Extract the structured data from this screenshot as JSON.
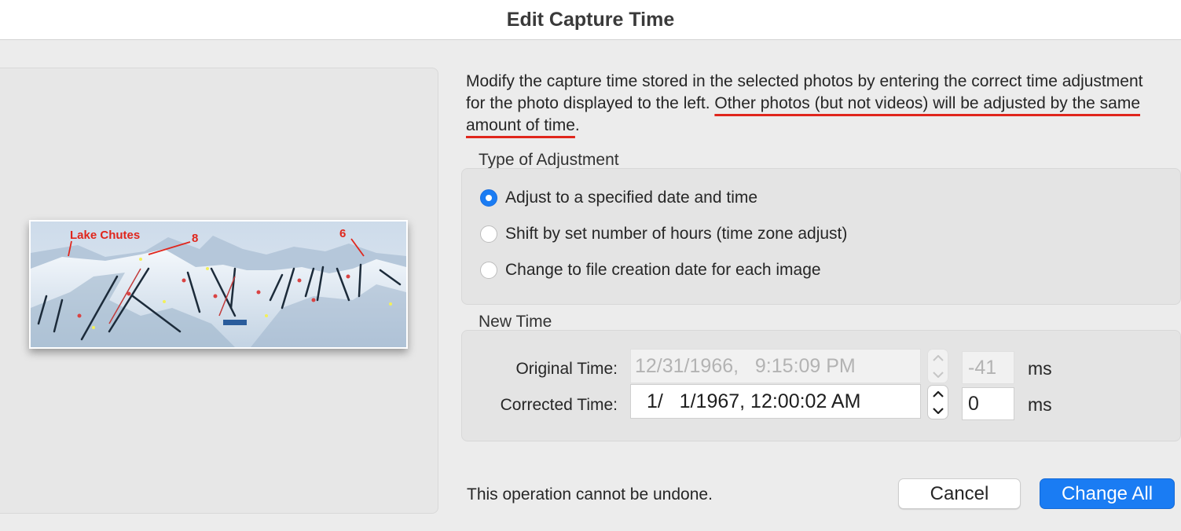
{
  "window": {
    "title": "Edit Capture Time"
  },
  "preview": {
    "map_labels": {
      "area": "Lake Chutes",
      "marker_a": "8",
      "marker_b": "6"
    },
    "accent_color": "#e0261c"
  },
  "description": {
    "part1": "Modify the capture time stored in the selected photos by entering the correct time adjustment for the photo displayed to the left. ",
    "part2_underlined": "Other photos (but not videos) will be adjusted by the same amount of time",
    "part3": "."
  },
  "adjustment_type": {
    "section_label": "Type of Adjustment",
    "options": [
      {
        "label": "Adjust to a specified date and time",
        "selected": true
      },
      {
        "label": "Shift by set number of hours (time zone adjust)",
        "selected": false
      },
      {
        "label": "Change to file creation date for each image",
        "selected": false
      }
    ]
  },
  "new_time": {
    "section_label": "New Time",
    "original": {
      "label": "Original Time:",
      "value": "12/31/1966,   9:15:09 PM",
      "ms": "-41",
      "enabled": false
    },
    "corrected": {
      "label": "Corrected Time:",
      "value": "1/   1/1967, 12:00:02 AM",
      "ms": "0",
      "enabled": true
    },
    "ms_unit": "ms"
  },
  "footer": {
    "note": "This operation cannot be undone.",
    "cancel_label": "Cancel",
    "primary_label": "Change All"
  },
  "colors": {
    "primary": "#1a7cf3",
    "highlight_underline": "#e0261c"
  },
  "icons": [
    "stepper-up-icon",
    "stepper-down-icon",
    "radio-selected-icon"
  ]
}
